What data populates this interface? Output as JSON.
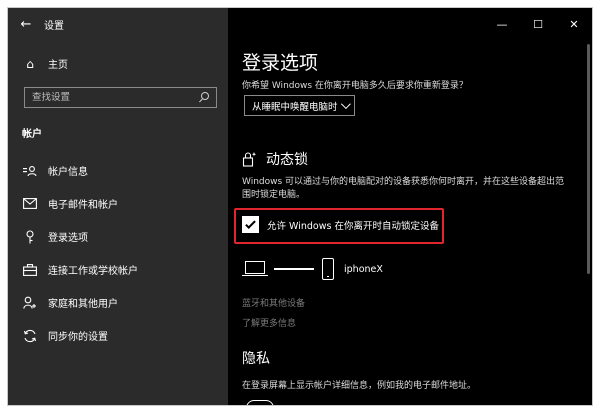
{
  "window": {
    "title": "设置",
    "controls": {
      "minimize": "—",
      "maximize": "☐",
      "close": "✕"
    }
  },
  "sidebar": {
    "home_label": "主页",
    "search_placeholder": "查找设置",
    "section_title": "帐户",
    "items": [
      {
        "label": "帐户信息",
        "icon": "account-info-icon"
      },
      {
        "label": "电子邮件和帐户",
        "icon": "mail-icon"
      },
      {
        "label": "登录选项",
        "icon": "key-icon",
        "active": true
      },
      {
        "label": "连接工作或学校帐户",
        "icon": "briefcase-icon"
      },
      {
        "label": "家庭和其他用户",
        "icon": "family-icon"
      },
      {
        "label": "同步你的设置",
        "icon": "sync-icon"
      }
    ]
  },
  "main": {
    "page_title": "登录选项",
    "require_signin_prompt": "你希望 Windows 在你离开电脑多久后要求你重新登录？",
    "require_signin_value": "从睡眠中唤醒电脑时",
    "dynamic_lock": {
      "title": "动态锁",
      "description": "Windows 可以通过与你的电脑配对的设备获悉你何时离开，并在这些设备超出范围时锁定电脑。",
      "checkbox_label": "允许 Windows 在你离开时自动锁定设备",
      "checked": true,
      "paired_device": "iphoneX",
      "link_bluetooth": "蓝牙和其他设备",
      "link_learn_more": "了解更多信息"
    },
    "privacy": {
      "title": "隐私",
      "description": "在登录屏幕上显示帐户详细信息，例如我的电子邮件地址。"
    }
  },
  "colors": {
    "sidebar_bg": "#2b2b2b",
    "main_bg": "#000000",
    "highlight": "#e0262c",
    "muted_link": "#7a7a7a"
  }
}
